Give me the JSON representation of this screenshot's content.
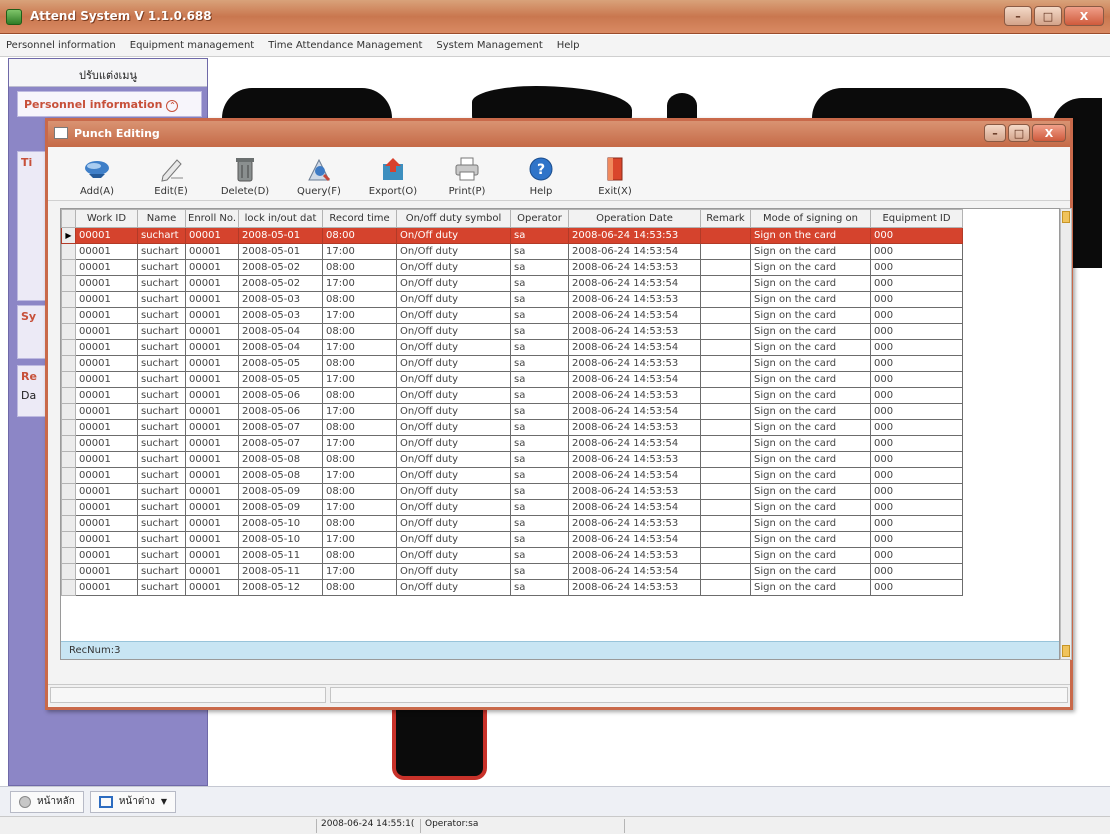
{
  "window": {
    "title": "Attend System V 1.1.0.688",
    "min": "–",
    "max": "□",
    "close": "X"
  },
  "menu": [
    "Personnel information",
    "Equipment management",
    "Time Attendance Management",
    "System Management",
    "Help"
  ],
  "left_panel": {
    "header": "ปรับแต่งเมนู",
    "personnel": "Personnel information",
    "sections": [
      "Ti",
      "Sy",
      "Re"
    ],
    "da_label": "Da"
  },
  "dialog": {
    "title": "Punch Editing",
    "toolbar": [
      {
        "label": "Add(A)",
        "icon": "add-icon"
      },
      {
        "label": "Edit(E)",
        "icon": "edit-icon"
      },
      {
        "label": "Delete(D)",
        "icon": "delete-icon"
      },
      {
        "label": "Query(F)",
        "icon": "query-icon"
      },
      {
        "label": "Export(O)",
        "icon": "export-icon"
      },
      {
        "label": "Print(P)",
        "icon": "print-icon"
      },
      {
        "label": "Help",
        "icon": "help-icon"
      },
      {
        "label": "Exit(X)",
        "icon": "exit-icon"
      }
    ],
    "columns": [
      "Work ID",
      "Name",
      "Enroll No.",
      "lock in/out dat",
      "Record time",
      "On/off duty symbol",
      "Operator",
      "Operation Date",
      "Remark",
      "Mode of signing on",
      "Equipment ID"
    ],
    "rows": [
      [
        "00001",
        "suchart",
        "00001",
        "2008-05-01",
        "08:00",
        "On/Off duty",
        "sa",
        "2008-06-24 14:53:53",
        "",
        "Sign on the card",
        "000"
      ],
      [
        "00001",
        "suchart",
        "00001",
        "2008-05-01",
        "17:00",
        "On/Off duty",
        "sa",
        "2008-06-24 14:53:54",
        "",
        "Sign on the card",
        "000"
      ],
      [
        "00001",
        "suchart",
        "00001",
        "2008-05-02",
        "08:00",
        "On/Off duty",
        "sa",
        "2008-06-24 14:53:53",
        "",
        "Sign on the card",
        "000"
      ],
      [
        "00001",
        "suchart",
        "00001",
        "2008-05-02",
        "17:00",
        "On/Off duty",
        "sa",
        "2008-06-24 14:53:54",
        "",
        "Sign on the card",
        "000"
      ],
      [
        "00001",
        "suchart",
        "00001",
        "2008-05-03",
        "08:00",
        "On/Off duty",
        "sa",
        "2008-06-24 14:53:53",
        "",
        "Sign on the card",
        "000"
      ],
      [
        "00001",
        "suchart",
        "00001",
        "2008-05-03",
        "17:00",
        "On/Off duty",
        "sa",
        "2008-06-24 14:53:54",
        "",
        "Sign on the card",
        "000"
      ],
      [
        "00001",
        "suchart",
        "00001",
        "2008-05-04",
        "08:00",
        "On/Off duty",
        "sa",
        "2008-06-24 14:53:53",
        "",
        "Sign on the card",
        "000"
      ],
      [
        "00001",
        "suchart",
        "00001",
        "2008-05-04",
        "17:00",
        "On/Off duty",
        "sa",
        "2008-06-24 14:53:54",
        "",
        "Sign on the card",
        "000"
      ],
      [
        "00001",
        "suchart",
        "00001",
        "2008-05-05",
        "08:00",
        "On/Off duty",
        "sa",
        "2008-06-24 14:53:53",
        "",
        "Sign on the card",
        "000"
      ],
      [
        "00001",
        "suchart",
        "00001",
        "2008-05-05",
        "17:00",
        "On/Off duty",
        "sa",
        "2008-06-24 14:53:54",
        "",
        "Sign on the card",
        "000"
      ],
      [
        "00001",
        "suchart",
        "00001",
        "2008-05-06",
        "08:00",
        "On/Off duty",
        "sa",
        "2008-06-24 14:53:53",
        "",
        "Sign on the card",
        "000"
      ],
      [
        "00001",
        "suchart",
        "00001",
        "2008-05-06",
        "17:00",
        "On/Off duty",
        "sa",
        "2008-06-24 14:53:54",
        "",
        "Sign on the card",
        "000"
      ],
      [
        "00001",
        "suchart",
        "00001",
        "2008-05-07",
        "08:00",
        "On/Off duty",
        "sa",
        "2008-06-24 14:53:53",
        "",
        "Sign on the card",
        "000"
      ],
      [
        "00001",
        "suchart",
        "00001",
        "2008-05-07",
        "17:00",
        "On/Off duty",
        "sa",
        "2008-06-24 14:53:54",
        "",
        "Sign on the card",
        "000"
      ],
      [
        "00001",
        "suchart",
        "00001",
        "2008-05-08",
        "08:00",
        "On/Off duty",
        "sa",
        "2008-06-24 14:53:53",
        "",
        "Sign on the card",
        "000"
      ],
      [
        "00001",
        "suchart",
        "00001",
        "2008-05-08",
        "17:00",
        "On/Off duty",
        "sa",
        "2008-06-24 14:53:54",
        "",
        "Sign on the card",
        "000"
      ],
      [
        "00001",
        "suchart",
        "00001",
        "2008-05-09",
        "08:00",
        "On/Off duty",
        "sa",
        "2008-06-24 14:53:53",
        "",
        "Sign on the card",
        "000"
      ],
      [
        "00001",
        "suchart",
        "00001",
        "2008-05-09",
        "17:00",
        "On/Off duty",
        "sa",
        "2008-06-24 14:53:54",
        "",
        "Sign on the card",
        "000"
      ],
      [
        "00001",
        "suchart",
        "00001",
        "2008-05-10",
        "08:00",
        "On/Off duty",
        "sa",
        "2008-06-24 14:53:53",
        "",
        "Sign on the card",
        "000"
      ],
      [
        "00001",
        "suchart",
        "00001",
        "2008-05-10",
        "17:00",
        "On/Off duty",
        "sa",
        "2008-06-24 14:53:54",
        "",
        "Sign on the card",
        "000"
      ],
      [
        "00001",
        "suchart",
        "00001",
        "2008-05-11",
        "08:00",
        "On/Off duty",
        "sa",
        "2008-06-24 14:53:53",
        "",
        "Sign on the card",
        "000"
      ],
      [
        "00001",
        "suchart",
        "00001",
        "2008-05-11",
        "17:00",
        "On/Off duty",
        "sa",
        "2008-06-24 14:53:54",
        "",
        "Sign on the card",
        "000"
      ],
      [
        "00001",
        "suchart",
        "00001",
        "2008-05-12",
        "08:00",
        "On/Off duty",
        "sa",
        "2008-06-24 14:53:53",
        "",
        "Sign on the card",
        "000"
      ]
    ],
    "selected_row": 0,
    "record_num": "RecNum:3"
  },
  "taskbar": {
    "home": "หน้าหลัก",
    "next": "หน้าต่าง"
  },
  "status": {
    "datetime": "2008-06-24 14:55:1(",
    "operator": "Operator:sa"
  },
  "colors": {
    "accent": "#c9694a",
    "selected": "#d5432d",
    "nav": "#8c86c6"
  }
}
